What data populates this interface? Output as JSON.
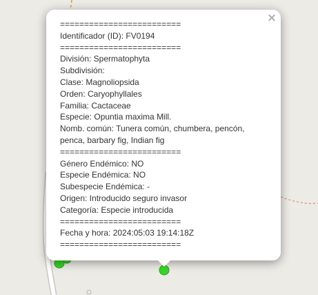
{
  "popup": {
    "close_symbol": "×",
    "separator": "=========================",
    "identificador": "Identificador (ID): FV0194",
    "division": "División: Spermatophyta",
    "subdivision": "Subdivisión:",
    "clase": "Clase: Magnoliopsida",
    "orden": "Orden: Caryophyllales",
    "familia": "Familia: Cactaceae",
    "especie": "Especie: Opuntia maxima Mill.",
    "nombre_comun": "Nomb. común: Tunera común, chumbera, pencón, penca, barbary fig, Indian fig",
    "genero_endemico": "Género Endémico: NO",
    "especie_endemica": "Especie Endémica: NO",
    "subespecie_endemica": "Subespecie Endémica: -",
    "origen": "Origen: Introducido seguro invasor",
    "categoria": "Categoría: Especie introducida",
    "fecha_hora": "Fecha y hora: 2024:05:03 19:14:18Z"
  },
  "map": {
    "background_color": "#ecebe6",
    "marker_color": "#3ad42a",
    "road_color": "#ffffff",
    "boundary_color": "#e8866f"
  }
}
